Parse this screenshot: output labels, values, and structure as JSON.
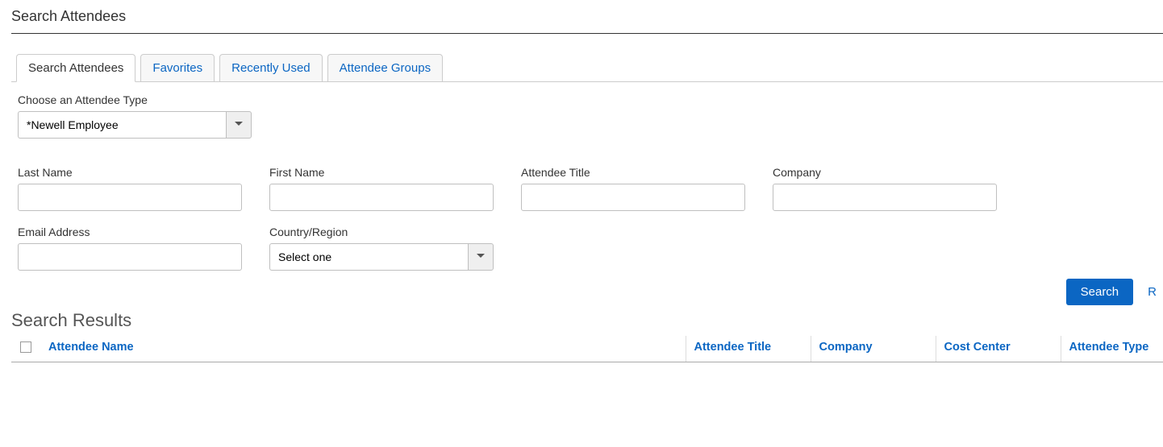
{
  "page": {
    "title": "Search Attendees"
  },
  "tabs": [
    {
      "label": "Search Attendees",
      "active": true
    },
    {
      "label": "Favorites",
      "active": false
    },
    {
      "label": "Recently Used",
      "active": false
    },
    {
      "label": "Attendee Groups",
      "active": false
    }
  ],
  "form": {
    "type_label": "Choose an Attendee Type",
    "type_value": "*Newell Employee",
    "last_name_label": "Last Name",
    "first_name_label": "First Name",
    "title_label": "Attendee Title",
    "company_label": "Company",
    "email_label": "Email Address",
    "country_label": "Country/Region",
    "country_value": "Select one"
  },
  "buttons": {
    "search": "Search",
    "reset_partial": "R"
  },
  "results": {
    "heading": "Search Results",
    "columns": {
      "name": "Attendee Name",
      "title": "Attendee Title",
      "company": "Company",
      "cost_center": "Cost Center",
      "type": "Attendee Type"
    }
  }
}
